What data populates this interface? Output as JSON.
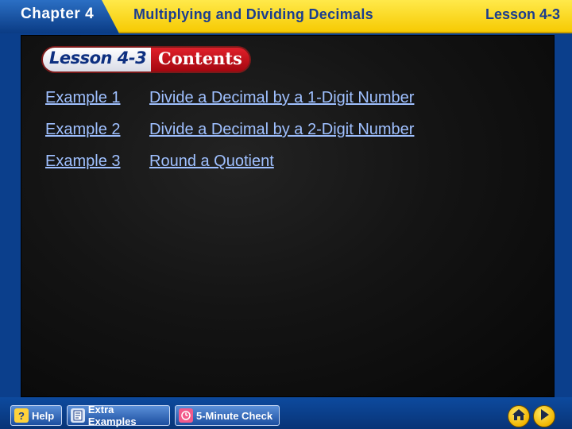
{
  "header": {
    "chapter": "Chapter 4",
    "title": "Multiplying and Dividing Decimals",
    "lesson": "Lesson 4-3"
  },
  "banner": {
    "lesson": "Lesson 4-3",
    "contents": "Contents"
  },
  "examples": [
    {
      "label": "Example 1",
      "title": "Divide a Decimal by a 1-Digit Number"
    },
    {
      "label": "Example 2",
      "title": "Divide a Decimal by a 2-Digit Number"
    },
    {
      "label": "Example 3",
      "title": "Round a Quotient"
    }
  ],
  "footer": {
    "help": "Help",
    "extra_examples": "Extra Examples",
    "five_minute_check": "5-Minute Check",
    "home_icon": "home-icon",
    "next_icon": "play-next-icon"
  },
  "colors": {
    "header_yellow": "#f6c900",
    "header_blue": "#0a3b84",
    "title_blue": "#1b3d8f",
    "board_black": "#141414",
    "link_blue": "#9fc0ff",
    "banner_red": "#c4101a"
  }
}
